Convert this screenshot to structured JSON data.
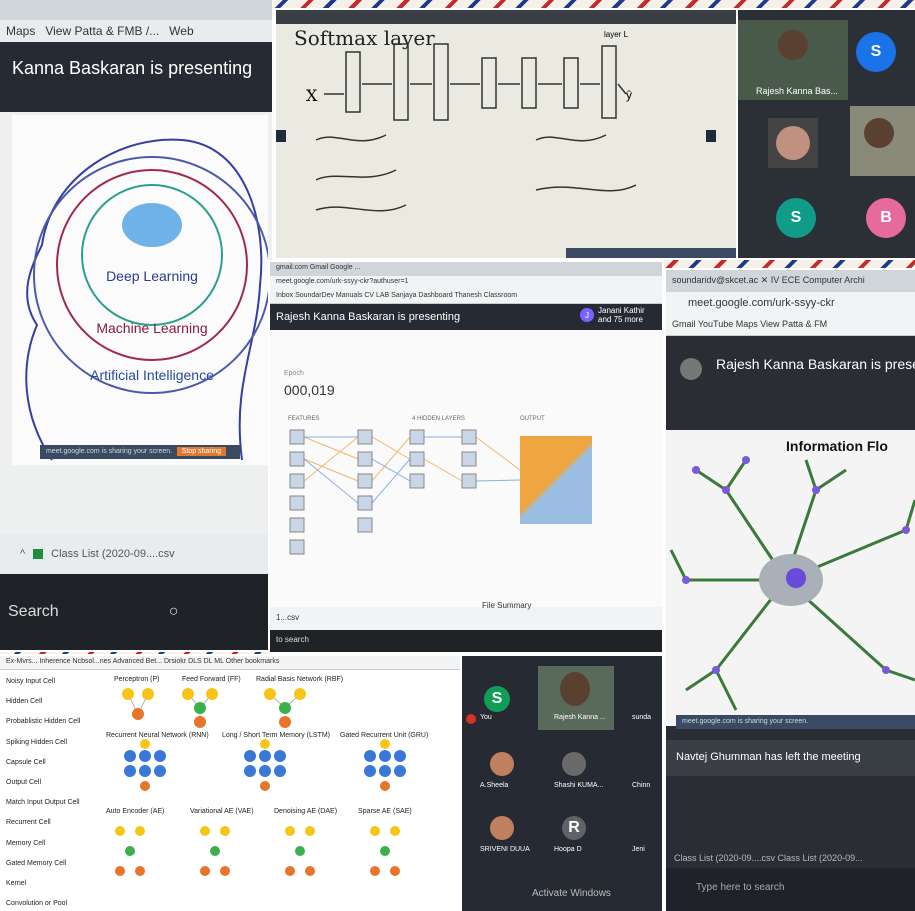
{
  "p1": {
    "bookmarks": [
      "Maps",
      "View Patta & FMB /...",
      "Web"
    ],
    "presenting": "Kanna Baskaran is presenting",
    "labels": {
      "dl": "Deep Learning",
      "ml": "Machine Learning",
      "ai": "Artificial Intelligence"
    },
    "share_text": "meet.google.com is sharing your screen.",
    "stop": "Stop sharing",
    "download": "Class List (2020-09....csv",
    "search": "Search"
  },
  "p2": {
    "title": "Softmax layer",
    "x": "X",
    "yhat": "ŷ",
    "layer": "layer L"
  },
  "p3": {
    "name": "Rajesh Kanna Bas...",
    "avatars": [
      {
        "letter": "S",
        "color": "#1a73e8"
      },
      {
        "letter": "S",
        "color": "#0f9d8a"
      },
      {
        "letter": "B",
        "color": "#e66b9c"
      }
    ]
  },
  "p4": {
    "tabs": "gmail.com  Gmail    Google    ...",
    "url": "meet.google.com/urk-ssyy-ckr?authuser=1",
    "bookmarks": "Inbox    SoundarDev Manuals    CV LAB    Sanjaya    Dashboard    Thanesh Classroom",
    "presenting": "Rajesh Kanna Baskaran is presenting",
    "people_initial": "J",
    "people": "Janani Kathir and 75 more",
    "epoch_label": "Epoch",
    "epoch": "000,019",
    "features": "FEATURES",
    "hidden": "4 HIDDEN LAYERS",
    "output": "OUTPUT",
    "download": "1...csv",
    "search": "to search",
    "files": "File Summary"
  },
  "p5": {
    "tabs": "soundaridv@skcet.ac  ✕   IV ECE Computer Archi",
    "url": "meet.google.com/urk-ssyy-ckr",
    "bookmarks": "Gmail    YouTube    Maps    View Patta & FM",
    "presenting": "Rajesh Kanna Baskaran is prese",
    "slide_title": "Information Flo",
    "share_text": "meet.google.com is sharing your screen.",
    "left_meeting": "Navtej Ghumman has left the meeting",
    "download": "Class List (2020-09....csv       Class List (2020-09...",
    "search": "Type here to search"
  },
  "p6": {
    "bookmarks": "Ex-Mvrs...    Inherence    Ncbsol...nes    Advanced Bet...    Drsiokr    DLS    DL    ML         Other bookmarks",
    "legend": [
      "Noisy Input Cell",
      "Hidden Cell",
      "Probablistic Hidden Cell",
      "Spiking Hidden Cell",
      "Capsule Cell",
      "Output Cell",
      "Match Input Output Cell",
      "Recurrent Cell",
      "Memory Cell",
      "Gated Memory Cell",
      "Kernel",
      "Convolution or Pool"
    ],
    "titles": {
      "p": "Perceptron (P)",
      "ff": "Feed Forward (FF)",
      "rbf": "Radial Basis Network (RBF)",
      "rnn": "Recurrent Neural Network (RNN)",
      "lstm": "Long / Short Term Memory (LSTM)",
      "gru": "Gated Recurrent Unit (GRU)",
      "ae": "Auto Encoder (AE)",
      "vae": "Variational AE (VAE)",
      "dae": "Denoising AE (DAE)",
      "sae": "Sparse AE (SAE)"
    }
  },
  "p7": {
    "participants": [
      "You",
      "Rajesh Kanna ...",
      "sunda",
      "A.Sheela",
      "Shashi KUMA...",
      "Chinn",
      "SRIVENI DUUA",
      "Hoopa D",
      "Jeni"
    ],
    "you_letter": "S",
    "hoopa_letter": "R",
    "activate": "Activate Windows"
  }
}
